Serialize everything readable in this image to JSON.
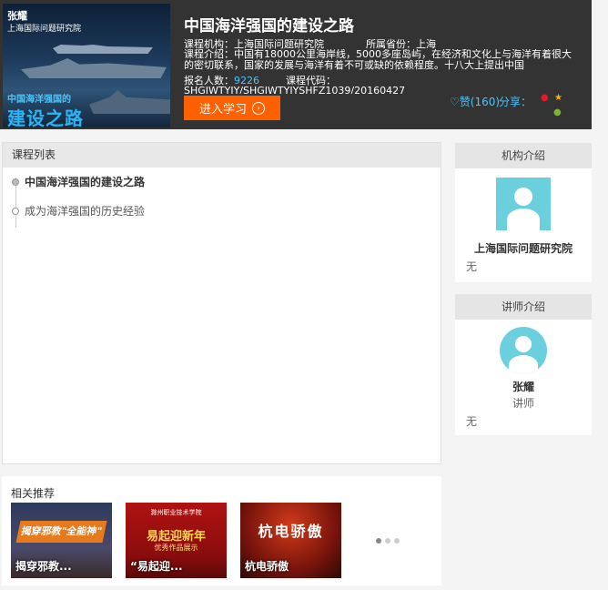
{
  "header": {
    "cover": {
      "name": "张耀",
      "org": "上海国际问题研究院",
      "subtitle": "中国海洋强国的",
      "big": "建设之路"
    },
    "title": "中国海洋强国的建设之路",
    "org_label": "课程机构：",
    "org_value": "上海国际问题研究院",
    "province_label": "所属省份：",
    "province_value": "上海",
    "intro_label": "课程介绍：",
    "intro_value": "中国有18000公里海岸线，5000多座岛屿，在经济和文化上与海洋有着很大的密切联系，国家的发展与海洋有着不可或缺的依赖程度。十八大上提出中国",
    "enroll_label": "报名人数：",
    "enroll_value": "9226",
    "code_label": "课程代码：",
    "code_value": "SHGJWTYJY/SHGJWTYJYSHFZ1039/20160427",
    "enter_button": "进入学习",
    "like_label": "赞(160)",
    "share_label": "分享："
  },
  "course_list": {
    "title": "课程列表",
    "chapters": [
      {
        "label": "中国海洋强国的建设之路"
      },
      {
        "label": "成为海洋强国的历史经验"
      }
    ]
  },
  "org_panel": {
    "title": "机构介绍",
    "name": "上海国际问题研究院",
    "desc": "无"
  },
  "teacher_panel": {
    "title": "讲师介绍",
    "name": "张耀",
    "role": "讲师",
    "desc": "无"
  },
  "related": {
    "title": "相关推荐",
    "items": [
      {
        "caption": "揭穿邪教...",
        "overlay": "揭穿邪教\"全能神\""
      },
      {
        "caption": "“易起迎...",
        "overlay_top": "滁州职业技术学院",
        "overlay": "易起迎新年",
        "overlay_sub": "优秀作品展示"
      },
      {
        "caption": "杭电骄傲",
        "overlay": "杭电骄傲"
      }
    ]
  },
  "colors": {
    "header_bg": "#333333",
    "accent_orange": "#ff6000",
    "link_blue": "#4fc3f7",
    "avatar_teal": "#6bd0de"
  }
}
